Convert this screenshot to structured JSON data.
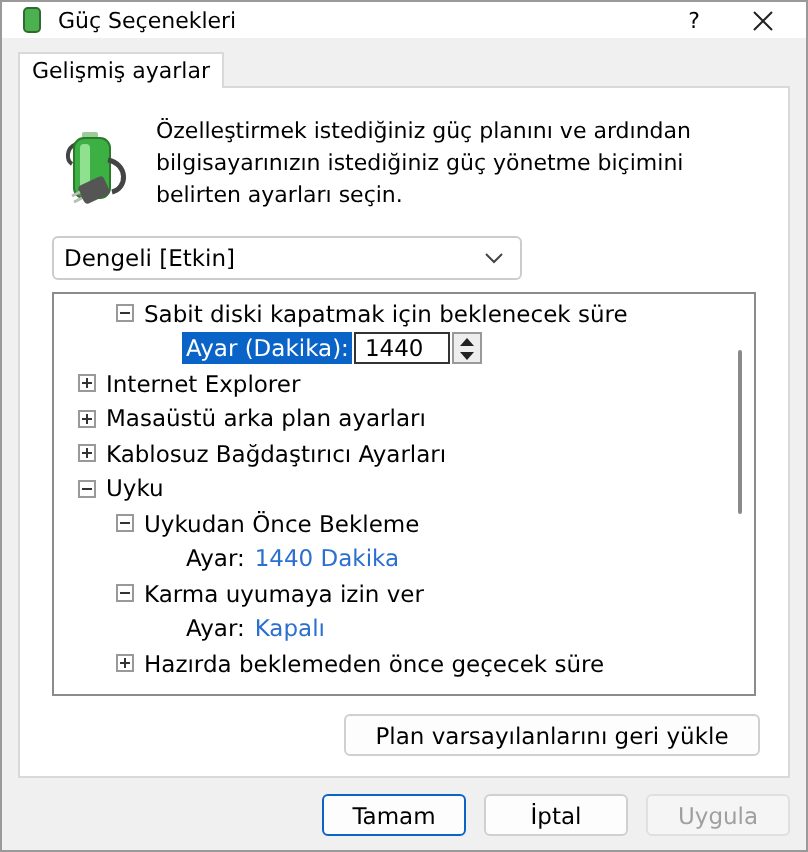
{
  "window": {
    "title": "Güç Seçenekleri",
    "help": "?"
  },
  "tabs": [
    {
      "label": "Gelişmiş ayarlar",
      "selected": true
    }
  ],
  "intro": "Özelleştirmek istediğiniz güç planını ve ardından bilgisayarınızın istediğiniz güç yönetme biçimini belirten ayarları seçin.",
  "plan_select": {
    "value": "Dengeli [Etkin]"
  },
  "tree": [
    {
      "kind": "hidden",
      "children": [
        {
          "kind": "group",
          "label": "Sabit diski kapatmak için beklenecek süre",
          "expanded": true,
          "children": [
            {
              "kind": "spin",
              "label": "Ayar (Dakika):",
              "value": "1440",
              "selected": true
            }
          ]
        }
      ]
    },
    {
      "kind": "group",
      "label": "Internet Explorer",
      "expanded": false
    },
    {
      "kind": "group",
      "label": "Masaüstü arka plan ayarları",
      "expanded": false
    },
    {
      "kind": "group",
      "label": "Kablosuz Bağdaştırıcı Ayarları",
      "expanded": false
    },
    {
      "kind": "group",
      "label": "Uyku",
      "expanded": true,
      "children": [
        {
          "kind": "group",
          "label": "Uykudan Önce Bekleme",
          "expanded": true,
          "children": [
            {
              "kind": "setting",
              "label": "Ayar:",
              "value": "1440 Dakika",
              "selected": false
            }
          ]
        },
        {
          "kind": "group",
          "label": "Karma uyumaya izin ver",
          "expanded": true,
          "children": [
            {
              "kind": "setting",
              "label": "Ayar:",
              "value": "Kapalı",
              "selected": false
            }
          ]
        },
        {
          "kind": "group",
          "label": "Hazırda beklemeden önce geçecek süre",
          "expanded": false
        }
      ]
    }
  ],
  "restore_button": "Plan varsayılanlarını geri yükle",
  "buttons": [
    {
      "label": "Tamam",
      "disabled": false,
      "default": true
    },
    {
      "label": "İptal",
      "disabled": false,
      "default": false
    },
    {
      "label": "Uygula",
      "disabled": true,
      "default": false
    }
  ]
}
